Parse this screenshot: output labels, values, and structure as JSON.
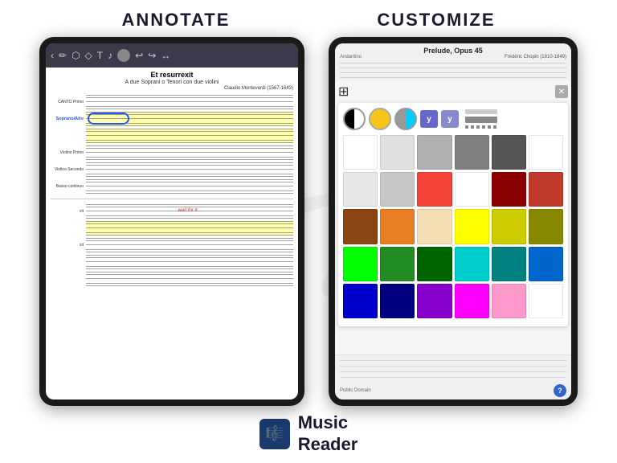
{
  "header": {
    "annotate_label": "ANNOTATE",
    "customize_label": "CUSTOMIZE"
  },
  "annotate_tablet": {
    "toolbar": {
      "back_label": "‹",
      "pencil_label": "✏",
      "lasso_label": "⬡",
      "diamond_label": "◇",
      "text_label": "T",
      "music_label": "♪",
      "undo_label": "↩",
      "redo_label": "↪",
      "arrows_label": "↔"
    },
    "score": {
      "title": "Et resurrexit",
      "subtitle": "A due Soprani o Tenori con due violini",
      "composer": "Claudio Monteverdi (1567-1643)",
      "parts": [
        {
          "label": "CANTO Primo",
          "highlighted": false
        },
        {
          "label": "Soprano/Alto",
          "highlighted": true,
          "oval": true
        },
        {
          "label": "",
          "highlighted": false
        },
        {
          "label": "Violino Primo",
          "highlighted": false
        },
        {
          "label": "Violino Secondo",
          "highlighted": false
        },
        {
          "label": "Basso continuo",
          "highlighted": false
        }
      ],
      "lower_parts": [
        {
          "label": "xit",
          "highlighted": false,
          "text": "wait for it..."
        },
        {
          "label": "",
          "highlighted": true
        },
        {
          "label": "xit",
          "highlighted": false
        },
        {
          "label": "",
          "highlighted": false
        },
        {
          "label": "",
          "highlighted": false
        }
      ]
    }
  },
  "customize_tablet": {
    "score": {
      "title": "Prelude, Opus 45",
      "composer": "Frédéric Chopin (1810-1849)",
      "subtitle": "Andantino",
      "public_domain": "Public Domain"
    },
    "color_panel": {
      "style_options": [
        {
          "type": "half",
          "label": "half-black-white"
        },
        {
          "type": "yellow",
          "label": "yellow"
        },
        {
          "type": "cyan",
          "label": "cyan-half"
        },
        {
          "type": "y",
          "label": "Y style 1"
        },
        {
          "type": "y2",
          "label": "Y style 2"
        }
      ],
      "colors": [
        "#ffffff",
        "#e0e0e0",
        "#b0b0b0",
        "#808080",
        "#555555",
        "#ffffff",
        "#e8e8e8",
        "#c8c8c8",
        "#f44336",
        "#ffffff",
        "#8B0000",
        "#c0392b",
        "#8B4513",
        "#e67e22",
        "#f5deb3",
        "#ffff00",
        "#cccc00",
        "#888800",
        "#00ff00",
        "#228B22",
        "#006400",
        "#00cccc",
        "#008080",
        "#0066cc",
        "#0000cc",
        "#000080",
        "#8800cc",
        "#ff00ff",
        "#ff99cc",
        "#ffffff"
      ],
      "help_label": "?"
    }
  },
  "footer": {
    "logo_icon": "🎼",
    "music_label": "Music",
    "reader_label": "Reader"
  }
}
